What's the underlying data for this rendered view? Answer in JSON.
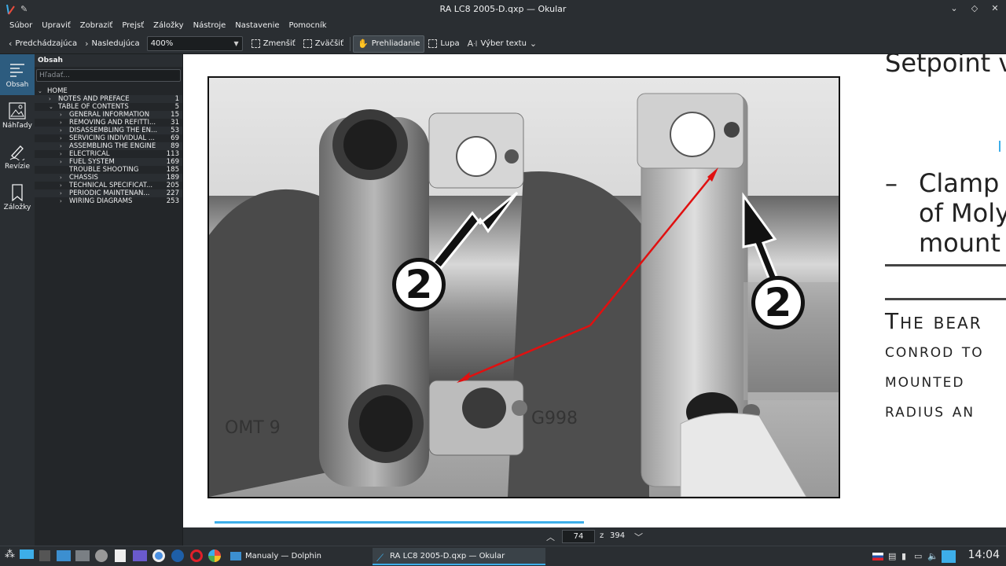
{
  "window": {
    "title": "RA LC8 2005-D.qxp — Okular"
  },
  "menu": [
    "Súbor",
    "Upraviť",
    "Zobraziť",
    "Prejsť",
    "Záložky",
    "Nástroje",
    "Nastavenie",
    "Pomocník"
  ],
  "toolbar": {
    "prev": "Predchádzajúca",
    "next": "Nasledujúca",
    "zoom_value": "400%",
    "zoom_out": "Zmenšiť",
    "zoom_in": "Zväčšiť",
    "browse": "Prehliadanie",
    "magnifier": "Lupa",
    "text_select": "Výber textu"
  },
  "sidebar": {
    "items": [
      {
        "label": "Obsah",
        "icon": "contents-icon"
      },
      {
        "label": "Náhľady",
        "icon": "thumbnails-icon"
      },
      {
        "label": "Revízie",
        "icon": "reviews-icon"
      },
      {
        "label": "Záložky",
        "icon": "bookmarks-icon"
      }
    ]
  },
  "contents": {
    "title": "Obsah",
    "search_placeholder": "Hľadať...",
    "tree": [
      {
        "label": "HOME",
        "page": "",
        "level": 0,
        "arrow": "open"
      },
      {
        "label": "NOTES AND PREFACE",
        "page": "1",
        "level": 1,
        "arrow": "closed"
      },
      {
        "label": "TABLE OF CONTENTS",
        "page": "5",
        "level": 1,
        "arrow": "open"
      },
      {
        "label": "GENERAL INFORMATION",
        "page": "15",
        "level": 2,
        "arrow": "closed"
      },
      {
        "label": "REMOVING AND REFITTI...",
        "page": "31",
        "level": 2,
        "arrow": "closed"
      },
      {
        "label": "DISASSEMBLING THE EN...",
        "page": "53",
        "level": 2,
        "arrow": "closed"
      },
      {
        "label": "SERVICING INDIVIDUAL ...",
        "page": "69",
        "level": 2,
        "arrow": "closed"
      },
      {
        "label": "ASSEMBLING THE ENGINE",
        "page": "89",
        "level": 2,
        "arrow": "closed"
      },
      {
        "label": "ELECTRICAL",
        "page": "113",
        "level": 2,
        "arrow": "closed"
      },
      {
        "label": "FUEL SYSTEM",
        "page": "169",
        "level": 2,
        "arrow": "closed"
      },
      {
        "label": "TROUBLE SHOOTING",
        "page": "185",
        "level": 2,
        "arrow": "none"
      },
      {
        "label": "CHASSIS",
        "page": "189",
        "level": 2,
        "arrow": "closed"
      },
      {
        "label": "TECHNICAL SPECIFICAT...",
        "page": "205",
        "level": 2,
        "arrow": "closed"
      },
      {
        "label": "PERIODIC MAINTENAN...",
        "page": "227",
        "level": 2,
        "arrow": "closed"
      },
      {
        "label": "WIRING DIAGRAMS",
        "page": "253",
        "level": 2,
        "arrow": "closed"
      }
    ]
  },
  "document": {
    "heading": "Setpoint v",
    "bullet_dash": "–",
    "bullet_lines": [
      "Clamp",
      "of Moly",
      "mount"
    ],
    "caps_lines": [
      "The bear",
      "conrod to",
      "mounted",
      "radius an"
    ],
    "callout_label": "2"
  },
  "pagenav": {
    "current_page": "74",
    "of_label": "z",
    "total_pages": "394"
  },
  "taskbar": {
    "tasks": [
      "Manualy — Dolphin",
      "RA LC8 2005-D.qxp — Okular"
    ],
    "clock": "14:04"
  },
  "colors": {
    "accent": "#3daee9",
    "selection": "#2d5c7f",
    "annotation_red": "#e01010"
  }
}
